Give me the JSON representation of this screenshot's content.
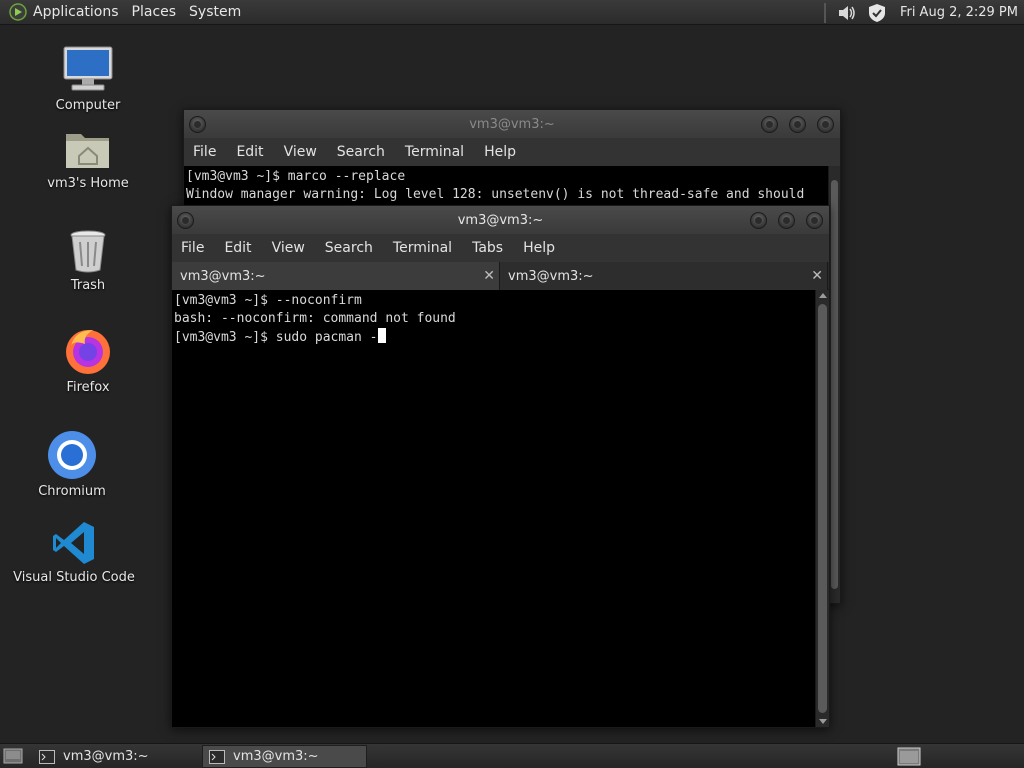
{
  "top_panel": {
    "menus": [
      "Applications",
      "Places",
      "System"
    ],
    "clock": "Fri Aug  2,  2:29 PM"
  },
  "desktop_icons": [
    {
      "label": "Computer",
      "icon": "computer-icon"
    },
    {
      "label": "vm3's Home",
      "icon": "home-folder-icon"
    },
    {
      "label": "Trash",
      "icon": "trash-icon"
    },
    {
      "label": "Firefox",
      "icon": "firefox-icon"
    },
    {
      "label": "Chromium",
      "icon": "chromium-icon"
    },
    {
      "label": "Visual Studio Code",
      "icon": "vscode-icon"
    }
  ],
  "back_window": {
    "title": "vm3@vm3:~",
    "menus": [
      "File",
      "Edit",
      "View",
      "Search",
      "Terminal",
      "Help"
    ],
    "lines": [
      "[vm3@vm3 ~]$ marco --replace",
      "Window manager warning: Log level 128: unsetenv() is not thread-safe and should"
    ]
  },
  "front_window": {
    "title": "vm3@vm3:~",
    "menus": [
      "File",
      "Edit",
      "View",
      "Search",
      "Terminal",
      "Tabs",
      "Help"
    ],
    "tabs": [
      {
        "label": "vm3@vm3:~",
        "close": "✕"
      },
      {
        "label": "vm3@vm3:~",
        "close": "✕"
      }
    ],
    "lines": [
      "[vm3@vm3 ~]$ --noconfirm",
      "bash: --noconfirm: command not found",
      "[vm3@vm3 ~]$ sudo pacman -"
    ]
  },
  "taskbar": {
    "buttons": [
      {
        "label": "vm3@vm3:~",
        "active": false
      },
      {
        "label": "vm3@vm3:~",
        "active": true
      }
    ]
  },
  "colors": {
    "desktop": "#232323",
    "terminal_bg": "#000000",
    "terminal_fg": "#d9d9d9"
  }
}
